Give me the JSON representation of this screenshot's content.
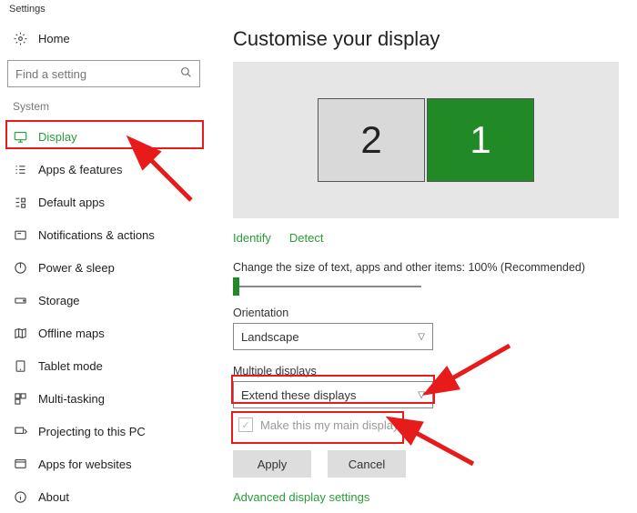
{
  "app": {
    "title": "Settings"
  },
  "sidebar": {
    "home_label": "Home",
    "search_placeholder": "Find a setting",
    "category": "System",
    "items": [
      {
        "label": "Display",
        "icon": "monitor"
      },
      {
        "label": "Apps & features",
        "icon": "list"
      },
      {
        "label": "Default apps",
        "icon": "default"
      },
      {
        "label": "Notifications & actions",
        "icon": "notif"
      },
      {
        "label": "Power & sleep",
        "icon": "power"
      },
      {
        "label": "Storage",
        "icon": "storage"
      },
      {
        "label": "Offline maps",
        "icon": "maps"
      },
      {
        "label": "Tablet mode",
        "icon": "tablet"
      },
      {
        "label": "Multi-tasking",
        "icon": "multitask"
      },
      {
        "label": "Projecting to this PC",
        "icon": "project"
      },
      {
        "label": "Apps for websites",
        "icon": "web"
      },
      {
        "label": "About",
        "icon": "about"
      }
    ]
  },
  "main": {
    "title": "Customise your display",
    "monitors": {
      "left": "2",
      "right": "1"
    },
    "identify": "Identify",
    "detect": "Detect",
    "scale_label": "Change the size of text, apps and other items: 100% (Recommended)",
    "orientation_label": "Orientation",
    "orientation_value": "Landscape",
    "multiple_label": "Multiple displays",
    "multiple_value": "Extend these displays",
    "make_main": "Make this my main display",
    "apply": "Apply",
    "cancel": "Cancel",
    "advanced": "Advanced display settings"
  },
  "colors": {
    "accent": "#218a27",
    "highlight": "#e81b1b"
  }
}
